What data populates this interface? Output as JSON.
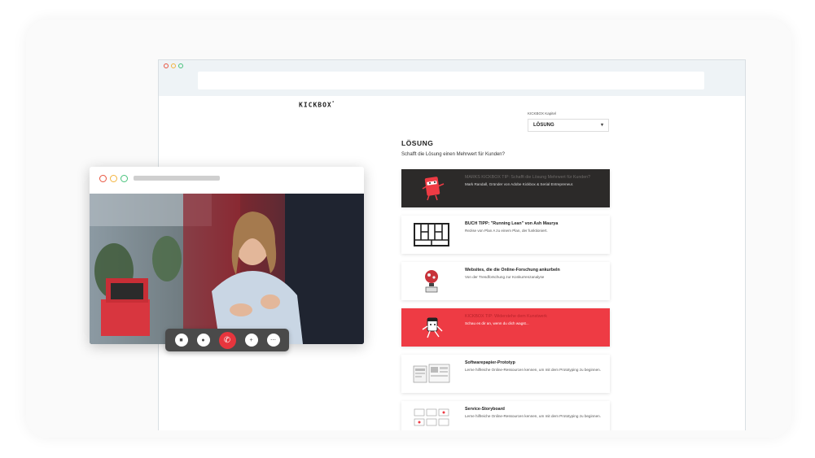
{
  "browser": {
    "logo": "KICKBOX",
    "logo_mark": "°",
    "select_label": "KICKBOX Kapitel",
    "select_value": "LÖSUNG",
    "heading": "LÖSUNG",
    "question": "Schafft die Lösung einen Mehrwert für Kunden?"
  },
  "cards": [
    {
      "title": "MARKS KICKBOX TIP: Schafft die Lösung Mehrwert für Kunden?",
      "subtitle": "Mark Randall, Gründer von Adobe Kickbox & Serial Entrepreneur.",
      "style": "dark",
      "icon": "kickbox-mascot-icon"
    },
    {
      "title": "BUCH TIPP: \"Running Lean\" von Ash Maurya",
      "subtitle": "Rezise von Plan A zu einem Plan, der funktioniert.",
      "style": "light",
      "icon": "lean-canvas-icon"
    },
    {
      "title": "Websites, die die Online-Forschung ankurbeln",
      "subtitle": "Von der Trendforschung zur Konkurrenzanalyse",
      "style": "light",
      "icon": "lightbulb-icon"
    },
    {
      "title": "KICKBOX TIP: Widerstehe dem Kunstwerk",
      "subtitle": "Schau es dir an, wenn du dich wagst...",
      "style": "red",
      "icon": "kickbox-mascot-icon"
    },
    {
      "title": "Softwarepapier-Prototyp",
      "subtitle": "Lerne hilfreiche Online-Ressourcen kennen, um mit dem Prototyping zu beginnen.",
      "style": "light",
      "icon": "wireframe-icon"
    },
    {
      "title": "Service-Storyboard",
      "subtitle": "Lerne hilfreiche Online-Ressourcen kennen, um mit dem Prototyping zu beginnen.",
      "style": "light",
      "icon": "storyboard-icon"
    }
  ],
  "video": {
    "controls": [
      "camera-icon",
      "microphone-icon",
      "end-call-icon",
      "add-person-icon",
      "more-icon"
    ]
  },
  "colors": {
    "accent_red": "#ee3b44",
    "dark_card": "#2c2a29",
    "dot_red": "#e8543f",
    "dot_yellow": "#f3b33c",
    "dot_green": "#46c27a"
  }
}
